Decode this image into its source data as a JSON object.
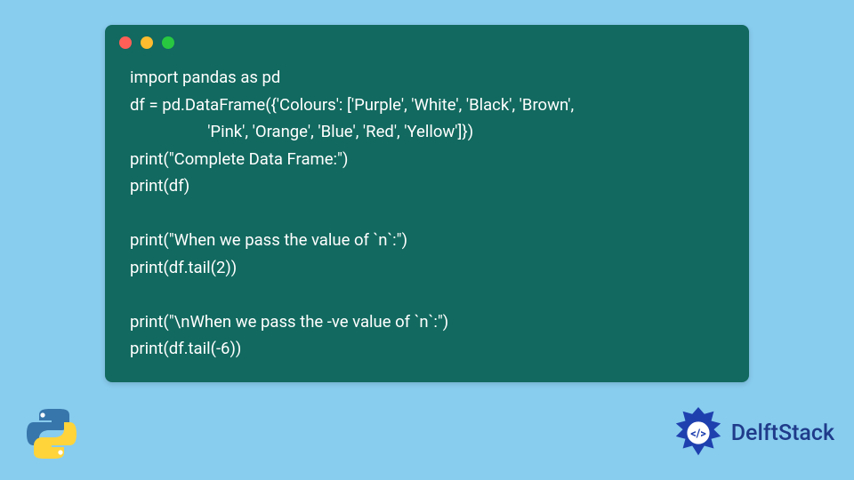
{
  "code": {
    "lines": [
      "import pandas as pd",
      "df = pd.DataFrame({'Colours': ['Purple', 'White', 'Black', 'Brown',",
      "                   'Pink', 'Orange', 'Blue', 'Red', 'Yellow']})",
      "print(\"Complete Data Frame:\")",
      "print(df)",
      "",
      "print(\"When we pass the value of `n`:\")",
      "print(df.tail(2))",
      "",
      "print(\"\\nWhen we pass the -ve value of `n`:\")",
      "print(df.tail(-6))"
    ]
  },
  "colors": {
    "page_bg": "#88ccee",
    "card_bg": "#12695f",
    "code_text": "#ffffff",
    "dot_red": "#ff5f57",
    "dot_yellow": "#febc2e",
    "dot_green": "#28c840",
    "brand_text": "#1f3b8a"
  },
  "brand": {
    "name": "DelftStack"
  },
  "icons": {
    "python": "python-logo-icon",
    "delft": "delft-badge-icon"
  }
}
